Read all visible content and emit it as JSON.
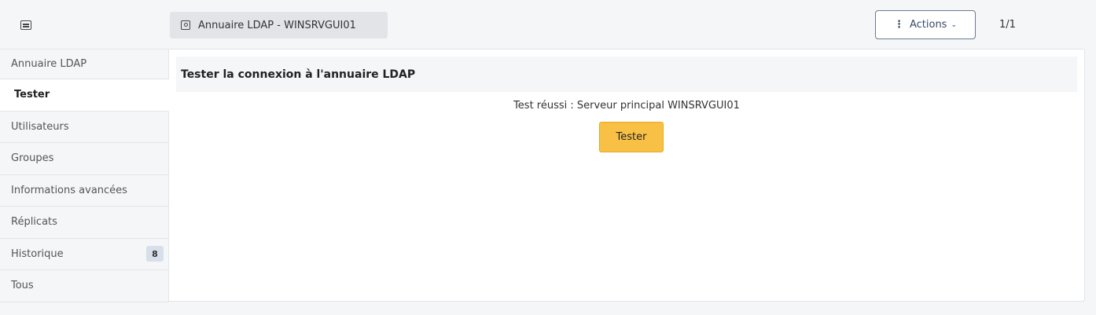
{
  "header": {
    "menu_icon": "list-icon",
    "title_icon": "contact-card-icon",
    "title": "Annuaire LDAP - WINSRVGUI01",
    "actions_label": "Actions",
    "actions_dots": "⋮",
    "actions_chevron": "⌄",
    "pager": "1/1"
  },
  "sidebar": {
    "items": [
      {
        "label": "Annuaire LDAP"
      },
      {
        "label": "Tester"
      },
      {
        "label": "Utilisateurs"
      },
      {
        "label": "Groupes"
      },
      {
        "label": "Informations avancées"
      },
      {
        "label": "Réplicats"
      },
      {
        "label": "Historique",
        "badge": "8"
      },
      {
        "label": "Tous"
      }
    ]
  },
  "main": {
    "section_title": "Tester la connexion à l'annuaire LDAP",
    "result_text": "Test réussi : Serveur principal WINSRVGUI01",
    "tester_button": "Tester"
  },
  "colors": {
    "accent_button": "#f8c146",
    "badge_bg": "#d7dfea",
    "actions_border": "#6b7a90"
  }
}
